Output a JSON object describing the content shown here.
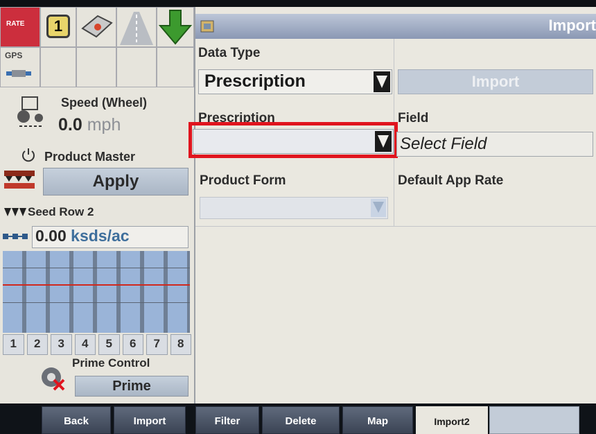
{
  "header": {
    "title": "Import"
  },
  "left": {
    "rate_tag": "RATE",
    "gps_tag": "GPS",
    "counter": "1",
    "speed_label": "Speed (Wheel)",
    "speed_value": "0.0",
    "speed_unit": "mph",
    "product_master_label": "Product Master",
    "apply_label": "Apply",
    "seed_row_label": "Seed Row 2",
    "seed_value": "0.00",
    "seed_unit": "ksds/ac",
    "row_numbers": [
      "1",
      "2",
      "3",
      "4",
      "5",
      "6",
      "7",
      "8"
    ],
    "prime_control_label": "Prime Control",
    "prime_label": "Prime"
  },
  "form": {
    "data_type_label": "Data Type",
    "data_type_value": "Prescription",
    "import_button": "Import",
    "prescription_label": "Prescription",
    "prescription_value": "",
    "field_label": "Field",
    "field_value": "Select Field",
    "product_form_label": "Product Form",
    "default_app_rate_label": "Default App Rate"
  },
  "footer": {
    "tabs": [
      "Back",
      "Import",
      "Filter",
      "Delete",
      "Map",
      "Import2"
    ]
  },
  "colors": {
    "highlight": "#e0141e",
    "header_text": "#ffffff",
    "button": "#b4bfcc"
  }
}
